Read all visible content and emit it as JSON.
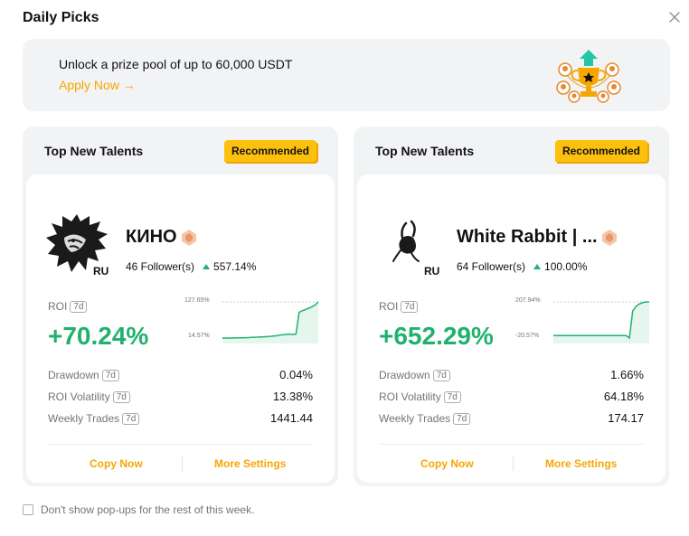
{
  "dialog": {
    "title": "Daily Picks",
    "close_icon": "close-icon"
  },
  "banner": {
    "text": "Unlock a prize pool of up to 60,000 USDT",
    "link": "Apply Now →",
    "art_icon": "trophy-icon"
  },
  "cards": [
    {
      "header": "Top New Talents",
      "badge": "Recommended",
      "name": "КИНО",
      "region": "RU",
      "followers": "46 Follower(s)",
      "follower_change": "557.14%",
      "roi_label": "ROI",
      "period": "7d",
      "roi_value": "+70.24%",
      "chart_max_label": "127.65%",
      "chart_min_label": "14.57%",
      "chart_values": [
        14.57,
        14.6,
        14.7,
        14.7,
        15,
        15.2,
        15.3,
        15.6,
        16,
        16.5,
        17,
        17.5,
        18,
        18.5,
        19,
        20,
        21,
        22,
        24,
        25,
        26,
        27,
        26,
        27,
        95,
        100,
        104,
        108,
        112,
        118,
        127.65
      ],
      "stats": [
        {
          "label": "Drawdown",
          "value": "0.04%"
        },
        {
          "label": "ROI Volatility",
          "value": "13.38%"
        },
        {
          "label": "Weekly Trades",
          "value": "1441.44"
        }
      ],
      "copy_label": "Copy Now",
      "settings_label": "More Settings"
    },
    {
      "header": "Top New Talents",
      "badge": "Recommended",
      "name": "White Rabbit | ...",
      "region": "RU",
      "followers": "64 Follower(s)",
      "follower_change": "100.00%",
      "roi_label": "ROI",
      "period": "7d",
      "roi_value": "+652.29%",
      "chart_max_label": "207.94%",
      "chart_min_label": "-20.57%",
      "chart_values": [
        -5,
        -5,
        -5,
        -5,
        -5,
        -5,
        -5,
        -5,
        -5,
        -5,
        -5,
        -5,
        -5,
        -5,
        -5,
        -5,
        -5,
        -5,
        -5,
        -5,
        -5,
        -5,
        -5,
        -20.57,
        150,
        180,
        195,
        203,
        207.94,
        207.5
      ],
      "stats": [
        {
          "label": "Drawdown",
          "value": "1.66%"
        },
        {
          "label": "ROI Volatility",
          "value": "64.18%"
        },
        {
          "label": "Weekly Trades",
          "value": "174.17"
        }
      ],
      "copy_label": "Copy Now",
      "settings_label": "More Settings"
    }
  ],
  "footer": {
    "checkbox_label": "Don't show pop-ups for the rest of this week."
  },
  "colors": {
    "accent": "#f7a600",
    "positive": "#20b26c",
    "badge": "#fcc00d",
    "panel": "#f2f3f5"
  }
}
